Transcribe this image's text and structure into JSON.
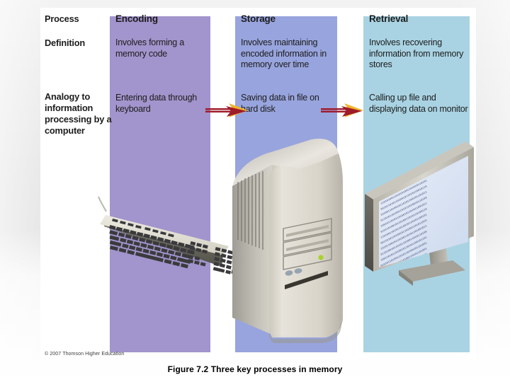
{
  "slide": {
    "caption": "Figure 7.2  Three key processes in memory",
    "copyright": "© 2007 Thomson Higher Education"
  },
  "figure": {
    "row_labels": {
      "process": "Process",
      "definition": "Definition",
      "analogy": "Analogy to information processing by a computer"
    },
    "columns": [
      {
        "key": "encoding",
        "header": "Encoding",
        "definition": "Involves forming a memory code",
        "analogy": "Entering data through keyboard",
        "color": "#a294cc",
        "art": "keyboard"
      },
      {
        "key": "storage",
        "header": "Storage",
        "definition": "Involves maintaining encoded information in memory over time",
        "analogy": "Saving data in file on hard disk",
        "color": "#98a4dd",
        "art": "computer-tower"
      },
      {
        "key": "retrieval",
        "header": "Retrieval",
        "definition": "Involves recovering information from memory stores",
        "analogy": "Calling up file and displaying data on monitor",
        "color": "#a9d3e3",
        "art": "monitor"
      }
    ],
    "arrows": [
      {
        "name": "arrow-encoding-to-storage",
        "from": "encoding",
        "to": "storage"
      },
      {
        "name": "arrow-storage-to-retrieval",
        "from": "storage",
        "to": "retrieval"
      }
    ],
    "arrow_colors": {
      "shaft": "#a01a2a",
      "head_front": "#9e1b28",
      "head_back": "#f0b429"
    }
  }
}
